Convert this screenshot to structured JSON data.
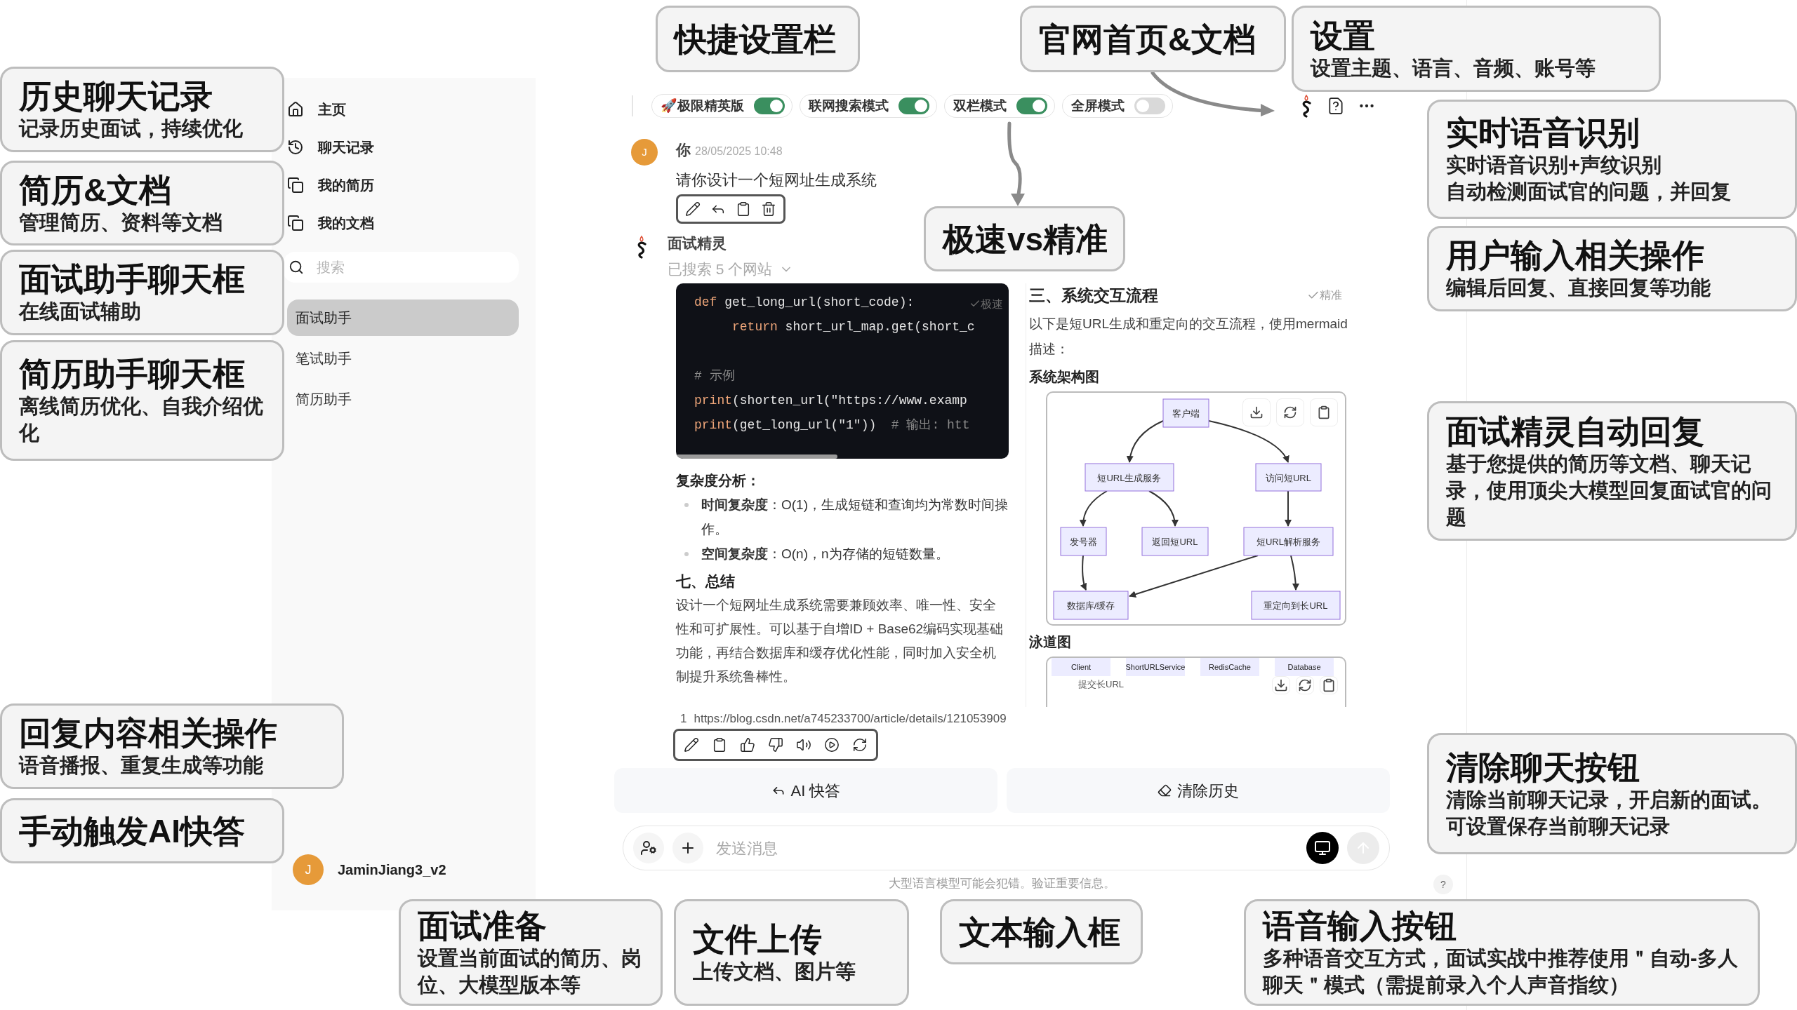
{
  "sidebar": {
    "nav": [
      {
        "label": "主页"
      },
      {
        "label": "聊天记录"
      },
      {
        "label": "我的简历"
      },
      {
        "label": "我的文档"
      }
    ],
    "search": {
      "placeholder": "搜索"
    },
    "assistants": [
      {
        "label": "面试助手",
        "selected": true
      },
      {
        "label": "笔试助手",
        "selected": false
      },
      {
        "label": "简历助手",
        "selected": false
      }
    ],
    "user": {
      "avatar": "J",
      "name": "JaminJiang3_v2"
    }
  },
  "toolbar": {
    "toggles": [
      {
        "label": "🚀极限精英版",
        "on": true
      },
      {
        "label": "联网搜索模式",
        "on": true
      },
      {
        "label": "双栏模式",
        "on": true
      },
      {
        "label": "全屏模式",
        "on": false
      }
    ]
  },
  "user_message": {
    "avatar": "J",
    "author": "你",
    "time": "28/05/2025 10:48",
    "text": "请你设计一个短网址生成系统"
  },
  "ai_message": {
    "author": "面试精灵",
    "search_status": "已搜索 5 个网站",
    "fast_column": {
      "badge": "极速",
      "code_lines": [
        {
          "kind": "code",
          "indent": false,
          "parts": [
            {
              "text": "def",
              "kind": "keyword"
            },
            {
              "text": " get_long_url(short_code):",
              "kind": "plain"
            }
          ]
        },
        {
          "kind": "code",
          "indent": true,
          "parts": [
            {
              "text": "return",
              "kind": "keyword"
            },
            {
              "text": " short_url_map.get(short_c",
              "kind": "plain"
            }
          ]
        },
        {
          "kind": "blank"
        },
        {
          "kind": "code",
          "indent": false,
          "parts": [
            {
              "text": "# 示例",
              "kind": "comment"
            }
          ]
        },
        {
          "kind": "code",
          "indent": false,
          "parts": [
            {
              "text": "print",
              "kind": "keyword"
            },
            {
              "text": "(shorten_url(\"https://www.examp",
              "kind": "plain"
            }
          ]
        },
        {
          "kind": "code",
          "indent": false,
          "parts": [
            {
              "text": "print",
              "kind": "keyword"
            },
            {
              "text": "(get_long_url(\"1\"))",
              "kind": "plain"
            },
            {
              "text": "  # 输出: htt",
              "kind": "comment"
            }
          ]
        }
      ],
      "heading": "复杂度分析：",
      "bullets": [
        "**时间复杂度**：O(1)，生成短链和查询均为常数时间操作。",
        "**空间复杂度**：O(n)，n为存储的短链数量。"
      ],
      "section_title": "七、总结",
      "summary": "设计一个短网址生成系统需要兼顾效率、唯一性、安全性和可扩展性。可以基于自增ID + Base62编码实现基础功能，再结合数据库和缓存优化性能，同时加入安全机制提升系统鲁棒性。"
    },
    "precise_column": {
      "badge": "精准",
      "title": "三、系统交互流程",
      "intro": "以下是短URL生成和重定向的交互流程，使用mermaid描述：",
      "diagram_title": "系统架构图",
      "nodes": [
        "客户端",
        "短URL生成服务",
        "访问短URL",
        "发号器",
        "返回短URL",
        "短URL解析服务",
        "数据库/缓存",
        "重定向到长URL"
      ],
      "lane_title": "泳道图",
      "lanes": [
        "Client",
        "ShortURLService",
        "RedisCache",
        "Database"
      ],
      "lane_step": "提交长URL"
    },
    "citation": {
      "index": "1",
      "url": "https://blog.csdn.net/a745233700/article/details/121053909"
    }
  },
  "actions": [
    {
      "label": "AI 快答"
    },
    {
      "label": "清除历史"
    }
  ],
  "composer": {
    "placeholder": "发送消息"
  },
  "disclaimer": "大型语言模型可能会犯错。验证重要信息。",
  "help": "?",
  "callouts": [
    {
      "title": "历史聊天记录",
      "lines": [
        "记录历史面试，持续优化"
      ]
    },
    {
      "title": "简历&文档",
      "lines": [
        "管理简历、资料等文档"
      ]
    },
    {
      "title": "面试助手聊天框",
      "lines": [
        "在线面试辅助"
      ]
    },
    {
      "title": "简历助手聊天框",
      "lines": [
        "离线简历优化、自我介绍优化"
      ]
    },
    {
      "title": "回复内容相关操作",
      "lines": [
        "语音播报、重复生成等功能"
      ]
    },
    {
      "title": "手动触发AI快答"
    },
    {
      "title": "快捷设置栏"
    },
    {
      "title": "官网首页&文档"
    },
    {
      "title": "设置",
      "lines": [
        "设置主题、语言、音频、账号等"
      ]
    },
    {
      "title": "实时语音识别",
      "lines": [
        "实时语音识别+声纹识别",
        "自动检测面试官的问题，并回复"
      ]
    },
    {
      "title": "用户输入相关操作",
      "lines": [
        "编辑后回复、直接回复等功能"
      ]
    },
    {
      "title": "极速vs精准"
    },
    {
      "title": "面试精灵自动回复",
      "lines": [
        "基于您提供的简历等文档、聊天记录，使用顶尖大模型回复面试官的问题"
      ]
    },
    {
      "title": "清除聊天按钮",
      "lines": [
        "清除当前聊天记录，开启新的面试。可设置保存当前聊天记录"
      ]
    },
    {
      "title": "面试准备",
      "lines": [
        "设置当前面试的简历、岗位、大模型版本等"
      ]
    },
    {
      "title": "文件上传",
      "lines": [
        "上传文档、图片等"
      ]
    },
    {
      "title": "文本输入框"
    },
    {
      "title": "语音输入按钮",
      "lines": [
        "多种语音交互方式，面试实战中推荐使用＂自动-多人聊天＂模式（需提前录入个人声音指纹）"
      ]
    }
  ]
}
